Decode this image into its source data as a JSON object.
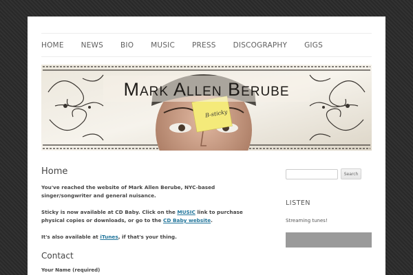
{
  "nav": {
    "items": [
      "HOME",
      "NEWS",
      "BIO",
      "MUSIC",
      "PRESS",
      "DISCOGRAPHY",
      "GIGS"
    ]
  },
  "banner": {
    "title": "Mark Allen Berube",
    "sticky_note": "B-sticky"
  },
  "main": {
    "title": "Home",
    "intro": "You've reached the website of Mark Allen Berube, NYC-based singer/songwriter and general nuisance.",
    "sticky_before": "Sticky is now available at CD Baby.  Click on the ",
    "sticky_link1": "MUSIC",
    "sticky_mid": " link to purchase physical copies or downloads, or go to the ",
    "sticky_link2": "CD Baby website",
    "sticky_after": ".",
    "itunes_before": "It's also available at ",
    "itunes_link": "iTunes",
    "itunes_after": ", if that's your thing.",
    "contact_title": "Contact",
    "name_label": "Your Name (required)"
  },
  "sidebar": {
    "search_placeholder": "",
    "search_button": "Search",
    "listen_title": "LISTEN",
    "listen_text": "Streaming tunes!"
  },
  "colors": {
    "link": "#21759b",
    "background": "#2b2b2b",
    "player": "#9a9a9a"
  }
}
